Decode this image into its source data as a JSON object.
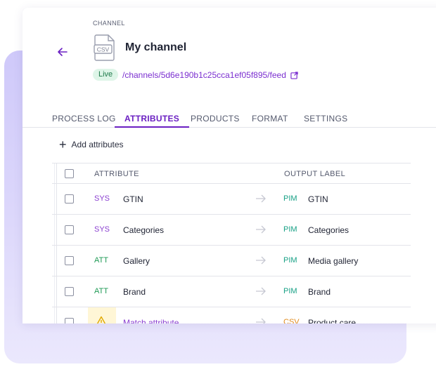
{
  "header": {
    "eyebrow": "CHANNEL",
    "title": "My channel",
    "status": "Live",
    "feed_path": "/channels/5d6e190b1c25cca1ef05f895/feed",
    "file_icon_text": "CSV"
  },
  "tabs": [
    {
      "label": "PROCESS LOG",
      "active": false
    },
    {
      "label": "ATTRIBUTES",
      "active": true
    },
    {
      "label": "PRODUCTS",
      "active": false
    },
    {
      "label": "FORMAT",
      "active": false
    },
    {
      "label": "SETTINGS",
      "active": false
    }
  ],
  "toolbar": {
    "add_label": "Add attributes"
  },
  "table": {
    "columns": [
      "ATTRIBUTE",
      "OUTPUT LABEL"
    ],
    "rows": [
      {
        "code": "SYS",
        "name": "GTIN",
        "out_code": "PIM",
        "out_name": "GTIN"
      },
      {
        "code": "SYS",
        "name": "Categories",
        "out_code": "PIM",
        "out_name": "Categories"
      },
      {
        "code": "ATT",
        "name": "Gallery",
        "out_code": "PIM",
        "out_name": "Media gallery"
      },
      {
        "code": "ATT",
        "name": "Brand",
        "out_code": "PIM",
        "out_name": "Brand"
      },
      {
        "code": "",
        "name": "Match attribute",
        "out_code": "CSV",
        "out_name": "Product care"
      }
    ]
  },
  "colors": {
    "accent": "#6a1fc2",
    "sys": "#8a3fd0",
    "att": "#1f9a55",
    "pim": "#16a085",
    "csv": "#e08a1a",
    "warning": "#f0b400"
  }
}
